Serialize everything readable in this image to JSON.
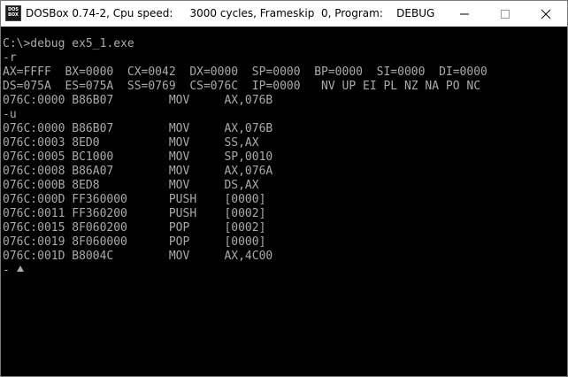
{
  "window": {
    "icon_text_line1": "DOS",
    "icon_text_line2": "BOX",
    "title": "DOSBox 0.74-2, Cpu speed:     3000 cycles, Frameskip  0, Program:    DEBUG",
    "controls": [
      "minimize-icon",
      "maximize-icon",
      "close-icon"
    ]
  },
  "terminal": {
    "foreground": "#aaaaaa",
    "background": "#000000",
    "lines": [
      "C:\\>debug ex5_1.exe",
      "-r",
      "AX=FFFF  BX=0000  CX=0042  DX=0000  SP=0000  BP=0000  SI=0000  DI=0000",
      "DS=075A  ES=075A  SS=0769  CS=076C  IP=0000   NV UP EI PL NZ NA PO NC",
      "076C:0000 B86B07        MOV     AX,076B",
      "-u",
      "076C:0000 B86B07        MOV     AX,076B",
      "076C:0003 8ED0          MOV     SS,AX",
      "076C:0005 BC1000        MOV     SP,0010",
      "076C:0008 B86A07        MOV     AX,076A",
      "076C:000B 8ED8          MOV     DS,AX",
      "076C:000D FF360000      PUSH    [0000]",
      "076C:0011 FF360200      PUSH    [0002]",
      "076C:0015 8F060200      POP     [0002]",
      "076C:0019 8F060000      POP     [0000]",
      "076C:001D B8004C        MOV     AX,4C00",
      "-"
    ]
  }
}
